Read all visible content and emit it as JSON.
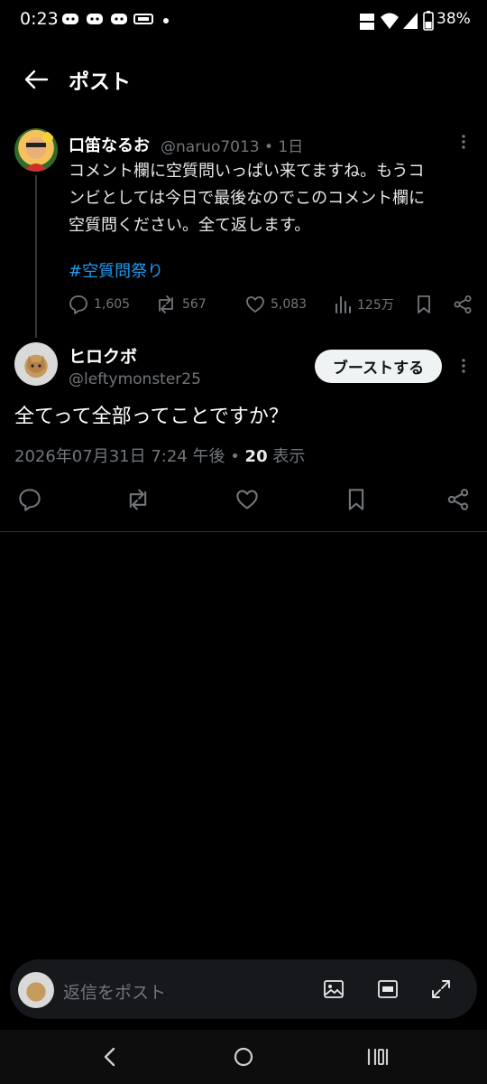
{
  "status_bar": {
    "time": "0:23",
    "icons": [
      "discord-icon",
      "discord-icon",
      "discord-icon",
      "smartnews-icon",
      "dot-icon",
      "volte-icon",
      "wifi-icon",
      "signal-icon",
      "battery-icon"
    ],
    "battery": "38%"
  },
  "header": {
    "title": "ポスト"
  },
  "parent_post": {
    "name": "口笛なるお",
    "handle": "@naruo7013 • 1日",
    "body_lines": [
      "コメント欄に空質問いっぱい来てますね。もうコ",
      "ンビとしては今日で最後なのでこのコメント欄に",
      "空質問ください。全て返します。"
    ],
    "hashtag": "#空質問祭り",
    "replies": "1,605",
    "reposts": "567",
    "likes": "5,083",
    "views": "125万"
  },
  "reply_post": {
    "name": "ヒロクボ",
    "handle": "@leftymonster25",
    "boost_label": "ブーストする",
    "body": "全てって全部ってことですか？",
    "date": "2026年07月31日 7:24 午後 • ",
    "views_count": "20",
    "views_label": " 表示"
  },
  "composer": {
    "placeholder": "返信をポスト"
  },
  "colors": {
    "background": "#000000",
    "accent": "#1d9bf0",
    "muted": "#71767b",
    "text": "#e7e9ea"
  }
}
